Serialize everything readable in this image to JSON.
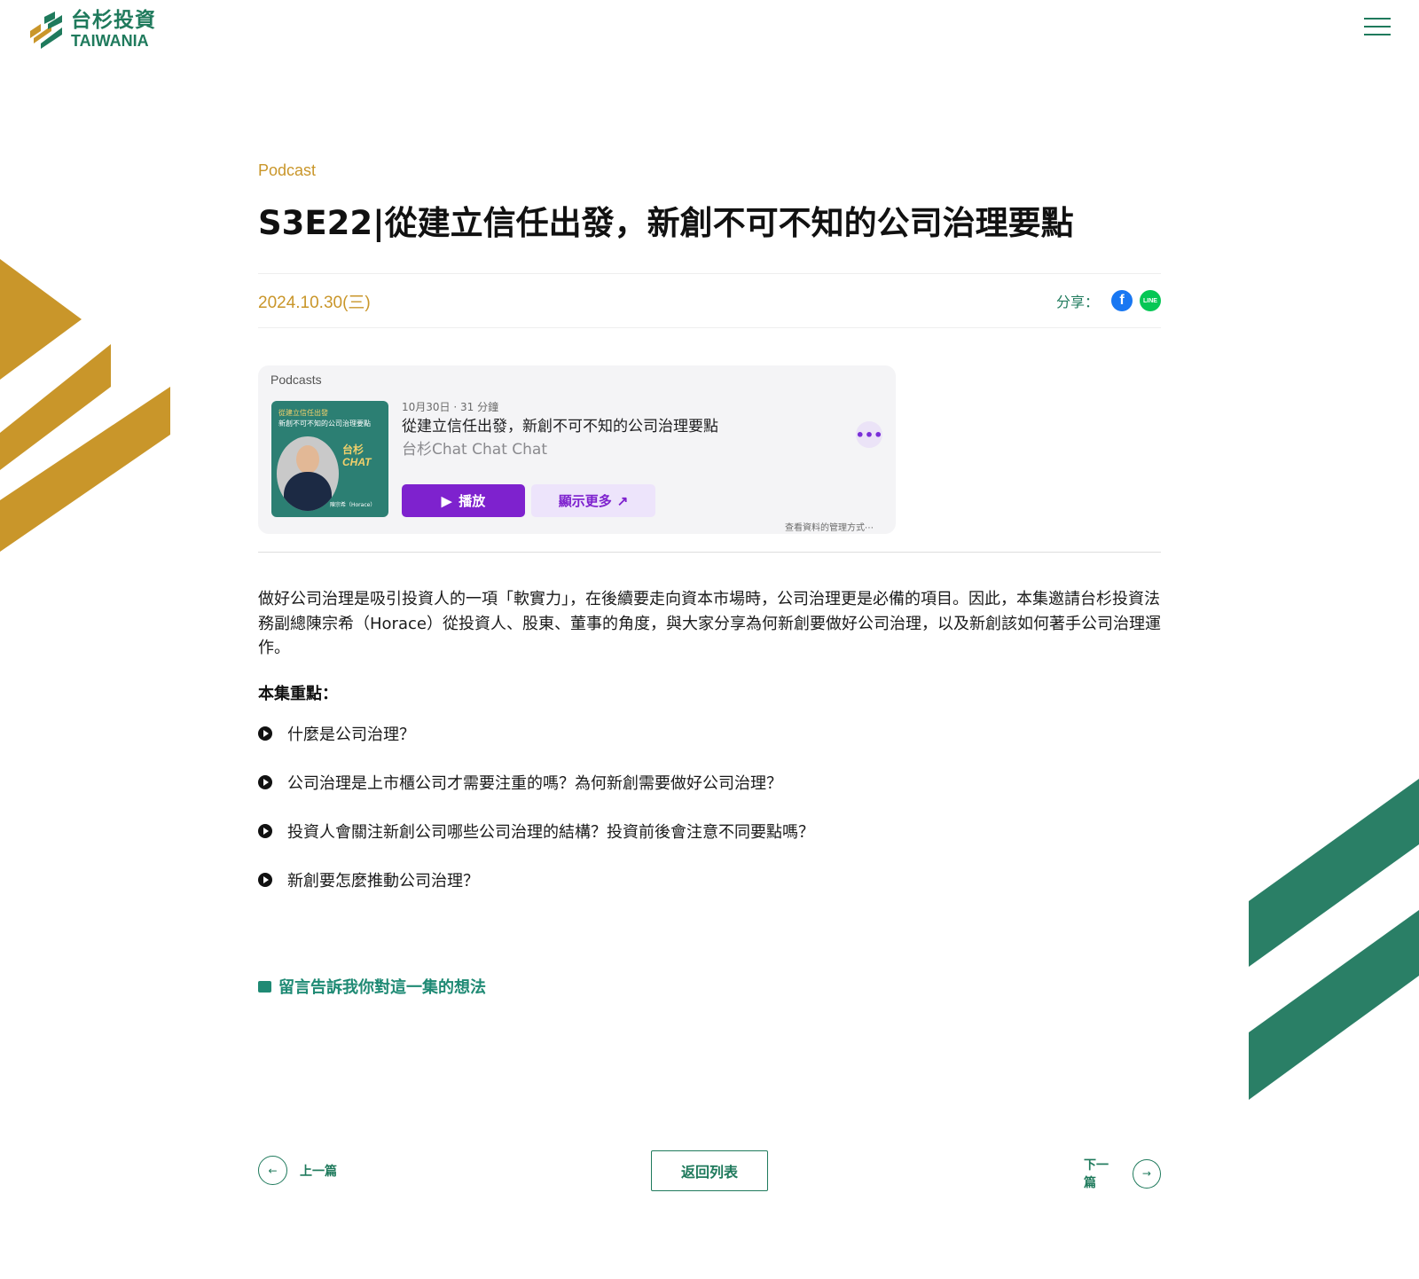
{
  "header": {
    "logo_cn": "台杉投資",
    "logo_en": "TAIWANIA"
  },
  "article": {
    "category": "Podcast",
    "title": "S3E22|從建立信任出發，新創不可不知的公司治理要點",
    "date": "2024.10.30(三)",
    "share_label": "分享："
  },
  "embed": {
    "brand": "Podcasts",
    "cover_line1": "從建立信任出發",
    "cover_line2": "新創不可不知的公司治理要點",
    "cover_chat": "台杉",
    "cover_chat2": "CHAT",
    "cover_name": "陳宗希（Horace）",
    "episode_meta": "10月30日 · 31 分鐘",
    "episode_title": "從建立信任出發，新創不可不知的公司治理要點",
    "show_name": "台杉Chat Chat Chat",
    "play_label": "播放",
    "more_label": "顯示更多",
    "data_link": "查看資料的管理方式⋯"
  },
  "body": {
    "intro": "做好公司治理是吸引投資人的一項「軟實力」，在後續要走向資本市場時，公司治理更是必備的項目。因此，本集邀請台杉投資法務副總陳宗希（Horace）從投資人、股東、董事的角度，與大家分享為何新創要做好公司治理，以及新創該如何著手公司治理運作。",
    "highlights_title": "本集重點：",
    "points": [
      "什麼是公司治理？",
      "公司治理是上市櫃公司才需要注重的嗎？為何新創需要做好公司治理？",
      "投資人會關注新創公司哪些公司治理的結構？投資前後會注意不同要點嗎？",
      "新創要怎麼推動公司治理？"
    ],
    "comment_link": "留言告訴我你對這一集的想法"
  },
  "nav": {
    "prev_label": "上一篇",
    "back_label": "返回列表",
    "next_label": "下一篇"
  },
  "colors": {
    "brand_green": "#1f7a5c",
    "brand_gold": "#c9962a",
    "podcast_purple": "#7e22ce"
  }
}
